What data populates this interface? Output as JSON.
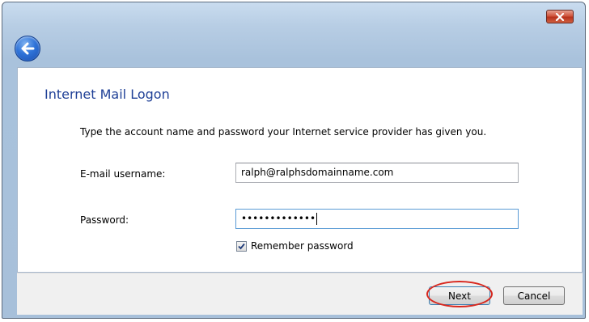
{
  "window": {
    "title": "Internet Mail Logon",
    "instruction": "Type the account name and password your Internet service provider has given you."
  },
  "titlebar": {
    "close_icon": "close-icon",
    "back_icon": "back-arrow-icon"
  },
  "form": {
    "username_label": "E-mail username:",
    "username_value": "ralph@ralphsdomainname.com",
    "password_label": "Password:",
    "password_value": "•••••••••••••",
    "remember_label": "Remember password",
    "remember_checked": true
  },
  "footer": {
    "next_label": "Next",
    "cancel_label": "Cancel"
  },
  "colors": {
    "title": "#1e3f96",
    "highlight": "#d8281e",
    "close_button": "#c8452c",
    "back_button": "#2f73d8"
  }
}
